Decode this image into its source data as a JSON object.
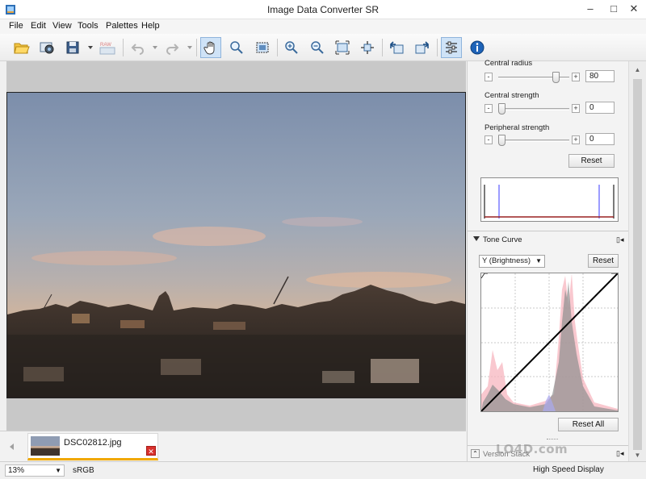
{
  "window": {
    "title": "Image Data Converter SR",
    "controls": {
      "minimize": "–",
      "maximize": "□",
      "close": "✕"
    }
  },
  "menubar": {
    "items": [
      "File",
      "Edit",
      "View",
      "Tools",
      "Palettes",
      "Help"
    ]
  },
  "toolbar": {
    "buttons": [
      {
        "name": "open-folder-icon"
      },
      {
        "name": "capture-camera-icon"
      },
      {
        "name": "save-disk-icon"
      },
      {
        "name": "raw-convert-icon",
        "label": "RAW"
      },
      {
        "name": "undo-icon"
      },
      {
        "name": "redo-icon"
      },
      {
        "name": "hand-tool-icon",
        "active": true
      },
      {
        "name": "magnifier-icon"
      },
      {
        "name": "crop-select-icon"
      },
      {
        "name": "zoom-in-icon"
      },
      {
        "name": "zoom-out-icon"
      },
      {
        "name": "fit-to-window-icon"
      },
      {
        "name": "actual-size-icon"
      },
      {
        "name": "rotate-left-icon"
      },
      {
        "name": "rotate-right-icon"
      },
      {
        "name": "adjustments-palette-icon",
        "active": true
      },
      {
        "name": "info-icon"
      }
    ]
  },
  "filmstrip": {
    "filename": "DSC02812.jpg",
    "close_label": "✕"
  },
  "statusbar": {
    "zoom": "13%",
    "color_space": "sRGB",
    "display_mode": "High Speed Display"
  },
  "panel": {
    "params": [
      {
        "label": "Central radius",
        "value": "80",
        "level": 0.85
      },
      {
        "label": "Central strength",
        "value": "0",
        "level": 0.0
      },
      {
        "label": "Peripheral strength",
        "value": "0",
        "level": 0.0
      }
    ],
    "minus": "-",
    "plus": "+",
    "reset_label": "Reset",
    "tone_curve": {
      "title": "Tone Curve",
      "channel": "Y (Brightness)",
      "reset_label": "Reset",
      "reset_all_label": "Reset All"
    },
    "version_stack": {
      "title": "Version Stack"
    }
  },
  "watermark": "LO4D.com",
  "colors": {
    "accent": "#f0a800",
    "active_button": "#cfe3f7",
    "close_red": "#d9302c"
  }
}
